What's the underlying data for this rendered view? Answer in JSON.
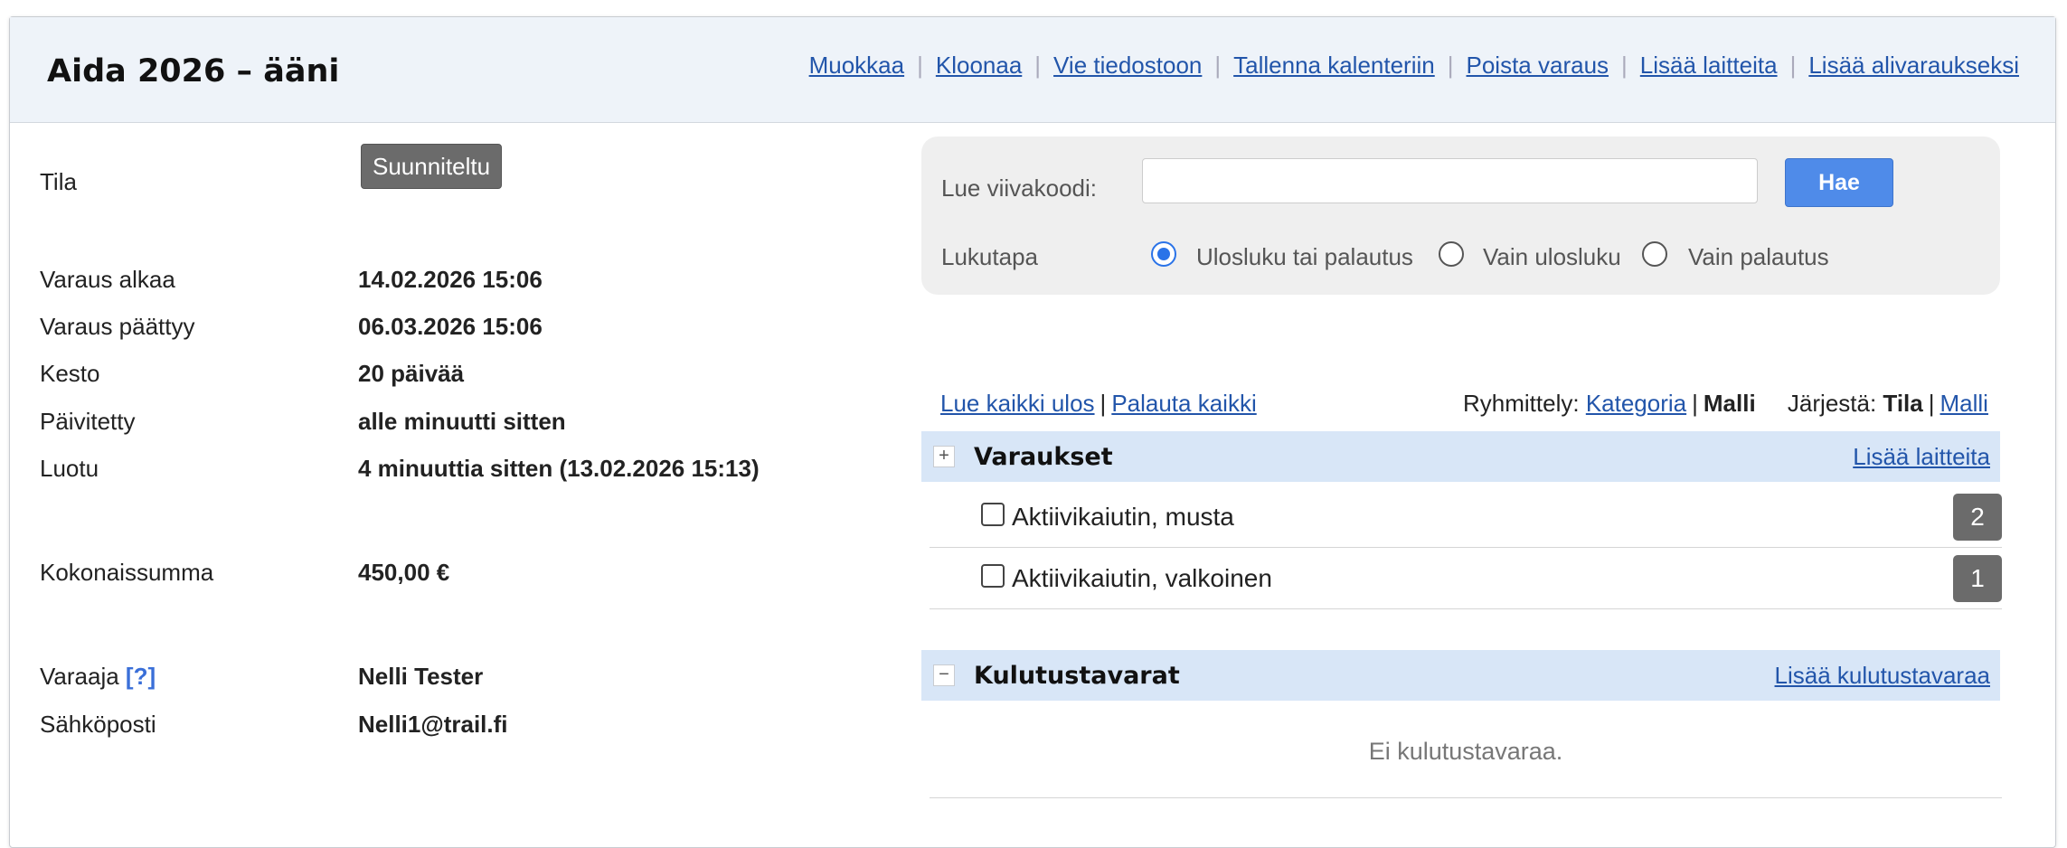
{
  "header": {
    "title": "Aida 2026 – ääni",
    "actions": [
      "Muokkaa",
      "Kloonaa",
      "Vie tiedostoon",
      "Tallenna kalenteriin",
      "Poista varaus",
      "Lisää laitteita",
      "Lisää alivaraukseksi"
    ]
  },
  "details": {
    "status_label": "Tila",
    "status_value": "Suunniteltu",
    "start_label": "Varaus alkaa",
    "start_value": "14.02.2026 15:06",
    "end_label": "Varaus päättyy",
    "end_value": "06.03.2026 15:06",
    "duration_label": "Kesto",
    "duration_value": "20 päivää",
    "updated_label": "Päivitetty",
    "updated_value": "alle minuutti sitten",
    "created_label": "Luotu",
    "created_value": "4 minuuttia sitten (13.02.2026 15:13)",
    "total_label": "Kokonaissumma",
    "total_value": "450,00 €",
    "booker_label": "Varaaja",
    "booker_help": "[?]",
    "booker_value": "Nelli Tester",
    "email_label": "Sähköposti",
    "email_value": "Nelli1@trail.fi"
  },
  "scanner": {
    "barcode_label": "Lue viivakoodi:",
    "barcode_value": "",
    "search_button": "Hae",
    "mode_label": "Lukutapa",
    "modes": [
      "Ulosluku tai palautus",
      "Vain ulosluku",
      "Vain palautus"
    ],
    "selected_mode": "Ulosluku tai palautus"
  },
  "toolbar": {
    "checkout_all": "Lue kaikki ulos",
    "return_all": "Palauta kaikki",
    "grouping_label": "Ryhmittely:",
    "grouping_category": "Kategoria",
    "grouping_model": "Malli",
    "sort_label": "Järjestä:",
    "sort_status": "Tila",
    "sort_model": "Malli"
  },
  "reservations": {
    "toggle": "+",
    "title": "Varaukset",
    "add_link": "Lisää laitteita",
    "items": [
      {
        "name": "Aktiivikaiutin, musta",
        "qty": "2"
      },
      {
        "name": "Aktiivikaiutin, valkoinen",
        "qty": "1"
      }
    ]
  },
  "consumables": {
    "toggle": "−",
    "title": "Kulutustavarat",
    "add_link": "Lisää kulutustavaraa",
    "empty_text": "Ei kulutustavaraa."
  },
  "colors": {
    "header_bg": "#eef3f9",
    "link": "#2255aa",
    "badge_gray": "#6b6b6b",
    "primary_button": "#4f8be9",
    "group_bar": "#d8e6f7"
  }
}
